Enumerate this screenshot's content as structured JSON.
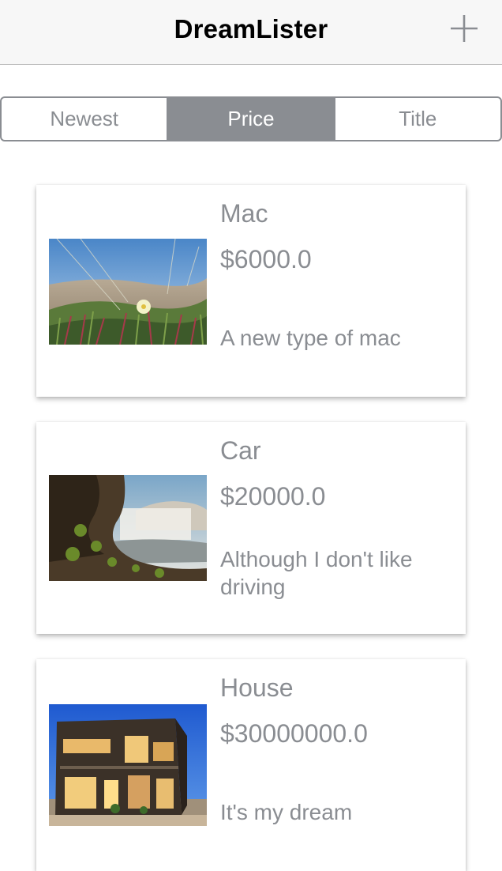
{
  "navbar": {
    "title": "DreamLister",
    "add_icon": "plus-icon"
  },
  "sort": {
    "options": [
      "Newest",
      "Price",
      "Title"
    ],
    "selected": "Price"
  },
  "items": [
    {
      "title": "Mac",
      "price": "$6000.0",
      "description": "A new type of mac",
      "image": "beach-flower-photo"
    },
    {
      "title": "Car",
      "price": "$20000.0",
      "description": "Although I don't like driving",
      "image": "waterfall-cliff-photo"
    },
    {
      "title": "House",
      "price": "$30000000.0",
      "description": "It's my dream",
      "image": "modern-house-photo"
    }
  ],
  "colors": {
    "accent_gray": "#8a8d92",
    "navbar_bg": "#f7f7f7",
    "text": "#000000"
  }
}
